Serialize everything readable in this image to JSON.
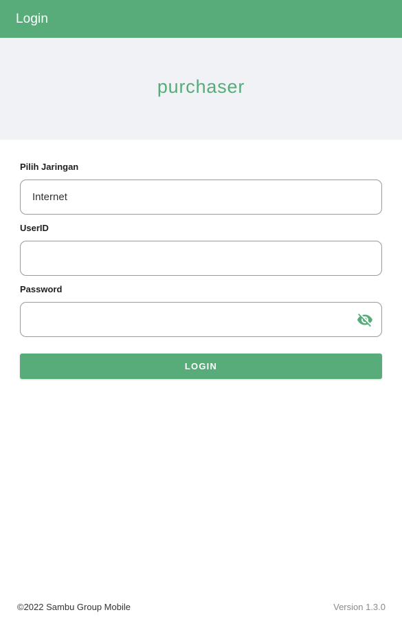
{
  "appbar": {
    "title": "Login",
    "color": "#58ac7a"
  },
  "brand": {
    "logo_text": "purchaser"
  },
  "form": {
    "network": {
      "label": "Pilih Jaringan",
      "value": "Internet"
    },
    "userid": {
      "label": "UserID",
      "value": "",
      "placeholder": ""
    },
    "password": {
      "label": "Password",
      "value": "",
      "placeholder": "",
      "toggle_icon": "eye-off-icon"
    },
    "login_button": {
      "label": "LOGIN"
    }
  },
  "footer": {
    "copyright": "©2022 Sambu Group Mobile",
    "version": "Version 1.3.0"
  }
}
